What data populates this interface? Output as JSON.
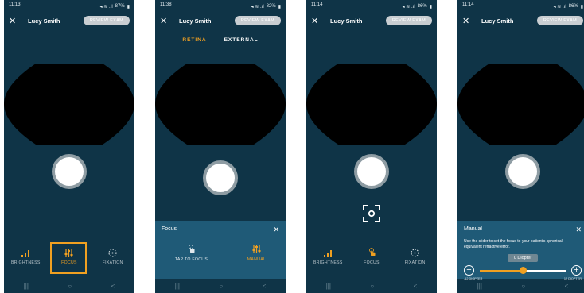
{
  "colors": {
    "bg": "#0f3447",
    "accent": "#f0a021",
    "sheet": "#1f5a77"
  },
  "screens": [
    {
      "status": {
        "time": "11:13",
        "battery": "87%"
      },
      "patient": "Lucy Smith",
      "review_label": "REVIEW EXAM",
      "controls": [
        {
          "label": "BRIGHTNESS",
          "icon": "signal-bars-icon"
        },
        {
          "label": "FOCUS",
          "icon": "sliders-icon"
        },
        {
          "label": "FIXATION",
          "icon": "fixation-target-icon"
        }
      ]
    },
    {
      "status": {
        "time": "11:38",
        "battery": "82%"
      },
      "patient": "Lucy Smith",
      "review_label": "REVIEW EXAM",
      "tabs": [
        {
          "label": "RETINA"
        },
        {
          "label": "EXTERNAL"
        }
      ],
      "sheet": {
        "title": "Focus",
        "options": [
          {
            "label": "TAP TO FOCUS",
            "icon": "tap-hand-icon"
          },
          {
            "label": "MANUAL",
            "icon": "sliders-icon"
          }
        ]
      }
    },
    {
      "status": {
        "time": "11:14",
        "battery": "86%"
      },
      "patient": "Lucy Smith",
      "review_label": "REVIEW EXAM",
      "controls": [
        {
          "label": "BRIGHTNESS",
          "icon": "signal-bars-icon"
        },
        {
          "label": "FOCUS",
          "icon": "tap-hand-icon"
        },
        {
          "label": "FIXATION",
          "icon": "fixation-target-icon"
        }
      ]
    },
    {
      "status": {
        "time": "11:14",
        "battery": "86%"
      },
      "patient": "Lucy Smith",
      "review_label": "REVIEW EXAM",
      "sheet": {
        "title": "Manual",
        "description": "Use the slider to set the focus to your patient's spherical-equivalent refractive error.",
        "tooltip": "0 Diopter",
        "min_label": "-12 DIOPTER",
        "max_label": "12 DIOPTER",
        "slider_fraction": 0.5
      }
    }
  ],
  "navbar": {
    "recent": "|||",
    "home": "○",
    "back": "<"
  }
}
